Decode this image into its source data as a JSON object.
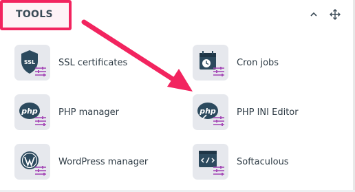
{
  "panel": {
    "title": "TOOLS",
    "controls": {
      "collapse_glyph": "^",
      "move_glyph": "move"
    }
  },
  "tools": [
    {
      "label": "SSL certificates",
      "icon": "ssl-shield-icon"
    },
    {
      "label": "Cron jobs",
      "icon": "calendar-clock-icon"
    },
    {
      "label": "PHP manager",
      "icon": "php-icon"
    },
    {
      "label": "PHP INI Editor",
      "icon": "php-ini-icon"
    },
    {
      "label": "WordPress manager",
      "icon": "wordpress-icon"
    },
    {
      "label": "Softaculous",
      "icon": "code-window-icon"
    }
  ],
  "icon_badge_text": {
    "ssl": "SSL",
    "php": "php"
  },
  "colors": {
    "accent": "#f2245f",
    "icon_dark": "#2c4a5e",
    "slider_purple": "#a64bb7",
    "icon_bg": "#e6e8ed",
    "text": "#2e3b45"
  }
}
